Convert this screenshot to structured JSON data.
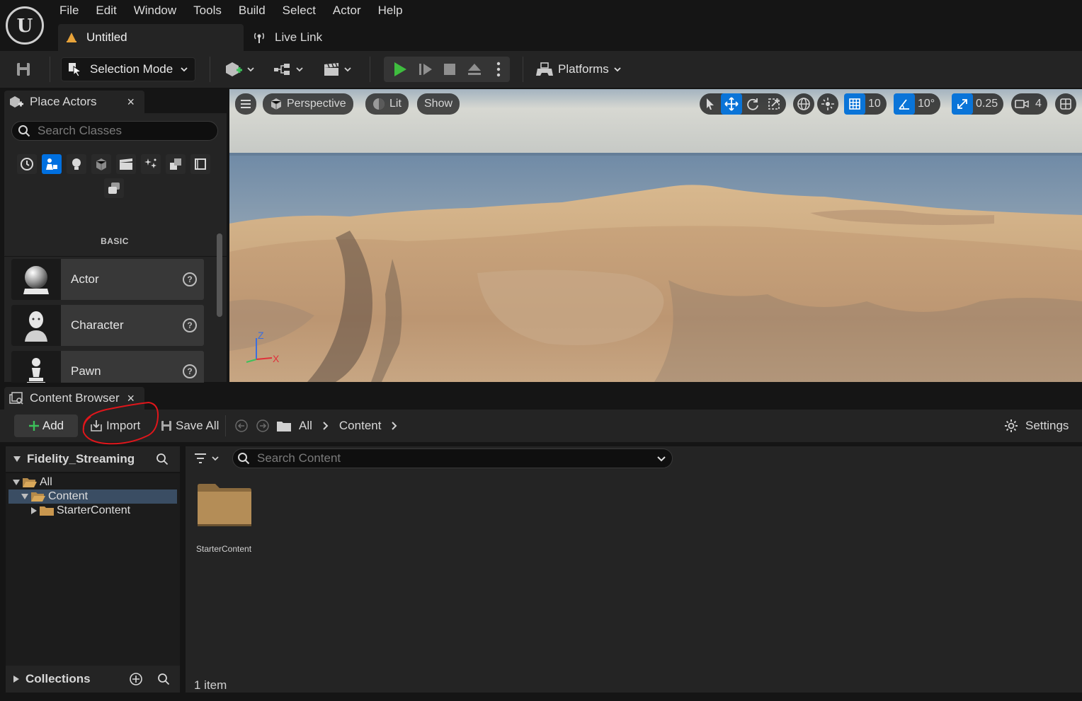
{
  "menu": [
    "File",
    "Edit",
    "Window",
    "Tools",
    "Build",
    "Select",
    "Actor",
    "Help"
  ],
  "tabs": {
    "level": "Untitled",
    "livelink": "Live Link"
  },
  "toolbar": {
    "selection_mode": "Selection Mode",
    "platforms": "Platforms"
  },
  "place_actors": {
    "title": "Place Actors",
    "close": "×",
    "search_placeholder": "Search Classes",
    "category_label": "BASIC",
    "categories": [
      "recent-icon",
      "basic-icon",
      "lights-icon",
      "shapes-icon",
      "cinematic-icon",
      "visual-effects-icon",
      "volumes-icon",
      "all-classes-icon",
      "geometry-icon"
    ],
    "items": [
      {
        "name": "Actor"
      },
      {
        "name": "Character"
      },
      {
        "name": "Pawn"
      }
    ],
    "help": "?"
  },
  "viewport": {
    "perspective": "Perspective",
    "lit": "Lit",
    "show": "Show",
    "grid_snap": "10",
    "rotation_snap": "10°",
    "scale_snap": "0.25",
    "camera_speed": "4",
    "axis": {
      "z": "Z",
      "x": "X"
    },
    "colors": {
      "sky_top": "#c9ccc8",
      "sea": "#7e95ad",
      "sand": "#c9a27a",
      "shadow": "#8a7a6c"
    }
  },
  "content_browser": {
    "title": "Content Browser",
    "close": "×",
    "add": "Add",
    "import": "Import",
    "save_all": "Save All",
    "path": [
      "All",
      "Content"
    ],
    "settings": "Settings",
    "project": "Fidelity_Streaming",
    "tree": [
      {
        "label": "All",
        "level": 0,
        "expanded": true
      },
      {
        "label": "Content",
        "level": 1,
        "expanded": true,
        "selected": true
      },
      {
        "label": "StarterContent",
        "level": 2,
        "expanded": false
      }
    ],
    "collections": "Collections",
    "search_placeholder": "Search Content",
    "assets": [
      {
        "name": "StarterContent"
      }
    ],
    "item_count": "1 item"
  },
  "accent_color": "#0070e0",
  "annotation_color": "#e0161b"
}
